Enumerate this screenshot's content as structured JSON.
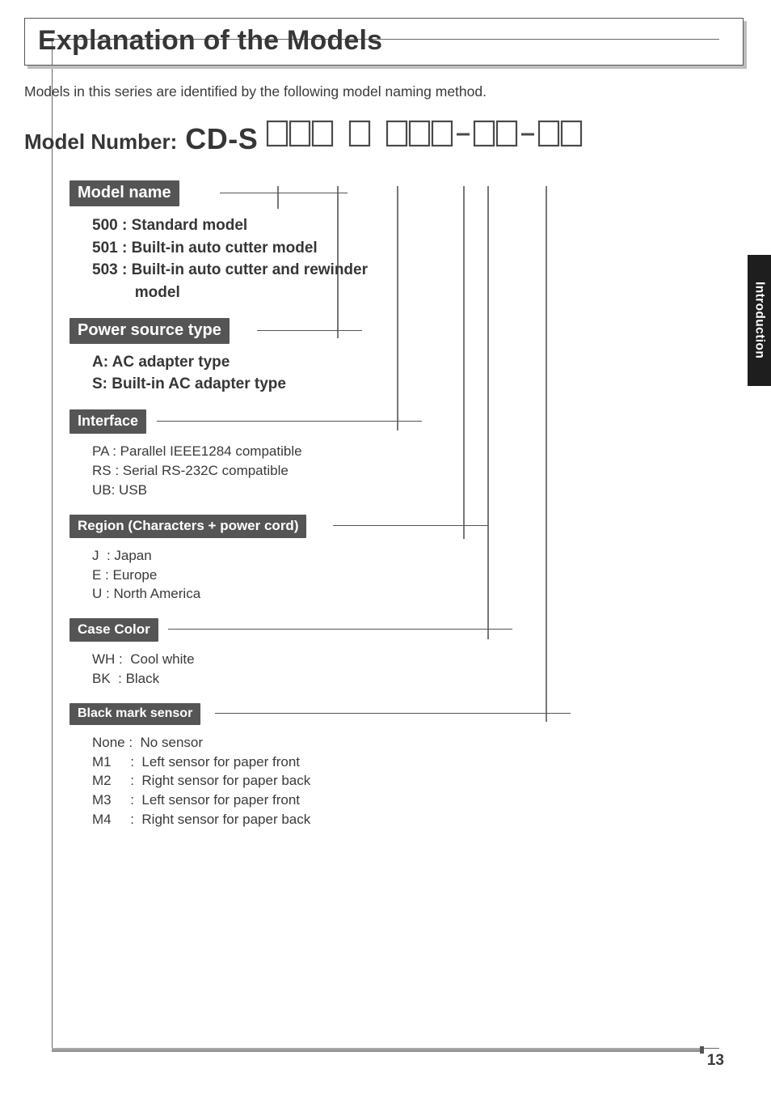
{
  "title": "Explanation of the Models",
  "intro": "Models in this series are identified by the following model naming method.",
  "model_label": "Model Number:",
  "model_prefix": "CD-S",
  "side_tab": "Introduction",
  "page_number": "13",
  "sections": {
    "model_name": {
      "header": "Model name",
      "lines": [
        "500 : Standard model",
        "501 : Built-in auto cutter model",
        "503 : Built-in auto cutter and rewinder",
        "          model"
      ]
    },
    "power_source": {
      "header": "Power source type",
      "lines": [
        "A: AC adapter type",
        "S: Built-in AC adapter type"
      ]
    },
    "interface": {
      "header": "Interface",
      "lines": [
        "PA : Parallel IEEE1284 compatible",
        "RS : Serial RS-232C compatible",
        "UB: USB"
      ]
    },
    "region": {
      "header": "Region (Characters + power cord)",
      "lines": [
        "J  : Japan",
        "E : Europe",
        "U : North America"
      ]
    },
    "case_color": {
      "header": "Case Color",
      "lines": [
        "WH :  Cool white",
        "BK  : Black"
      ]
    },
    "black_mark": {
      "header": "Black mark sensor",
      "lines": [
        "None :  No sensor",
        "M1     :  Left sensor for paper front",
        "M2     :  Right sensor for paper back",
        "M3     :  Left sensor for paper front",
        "M4     :  Right sensor for paper back"
      ]
    }
  }
}
